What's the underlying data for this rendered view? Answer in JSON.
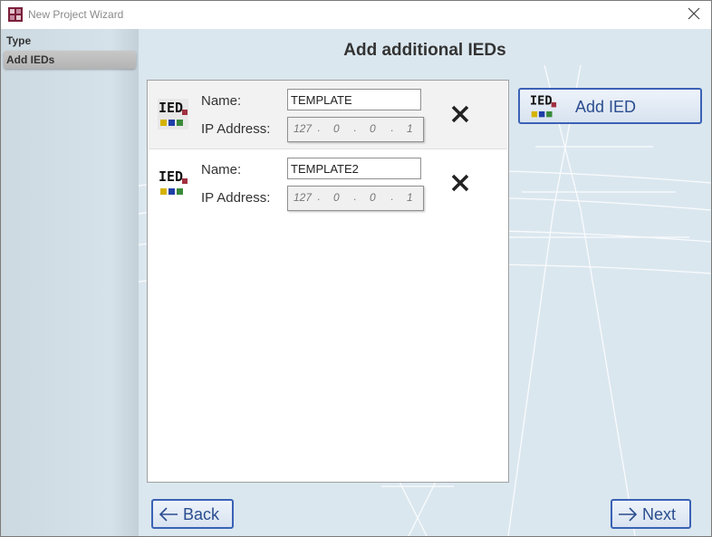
{
  "window": {
    "title": "New Project Wizard"
  },
  "sidebar": {
    "items": [
      {
        "label": "Type"
      },
      {
        "label": "Add IEDs"
      }
    ]
  },
  "main": {
    "heading": "Add additional IEDs"
  },
  "labels": {
    "name": "Name:",
    "ip": "IP Address:"
  },
  "ieds": [
    {
      "name": "TEMPLATE",
      "ip": [
        "127",
        "0",
        "0",
        "1"
      ],
      "selected": true
    },
    {
      "name": "TEMPLATE2",
      "ip": [
        "127",
        "0",
        "0",
        "1"
      ],
      "selected": false
    }
  ],
  "buttons": {
    "add_ied": "Add IED",
    "back": "Back",
    "next": "Next"
  },
  "icons": {
    "ied": "ied-icon",
    "remove": "close-icon",
    "back": "arrow-left-icon",
    "next": "arrow-right-icon",
    "close": "close-icon"
  },
  "colors": {
    "accent": "#3a62b5",
    "background": "#dbe7ef"
  }
}
